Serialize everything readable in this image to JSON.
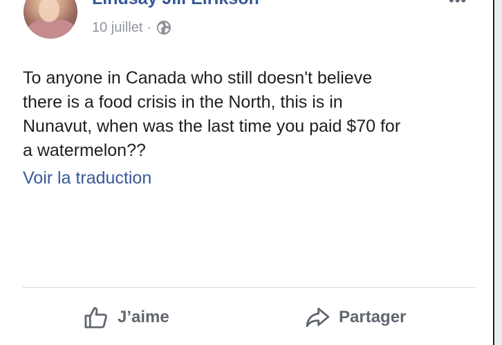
{
  "post": {
    "author": "Lindsay Jill Eirikson",
    "date": "10 juillet",
    "separator": "·",
    "privacy_icon": "globe-icon",
    "more_icon": "more-options-icon",
    "more_glyph": "•••",
    "text_lines": [
      "To anyone in Canada who still doesn't believe",
      "there is a food crisis in the North, this is in",
      "Nunavut, when was the last time you paid $70 for",
      "a watermelon??"
    ],
    "translate_label": "Voir la traduction"
  },
  "actions": {
    "like_label": "J’aime",
    "like_icon": "thumbs-up-icon",
    "share_label": "Partager",
    "share_icon": "share-arrow-icon"
  },
  "colors": {
    "link": "#385898",
    "text": "#1c1e21",
    "meta": "#90949c",
    "action": "#606770",
    "divider": "#dadde1"
  }
}
